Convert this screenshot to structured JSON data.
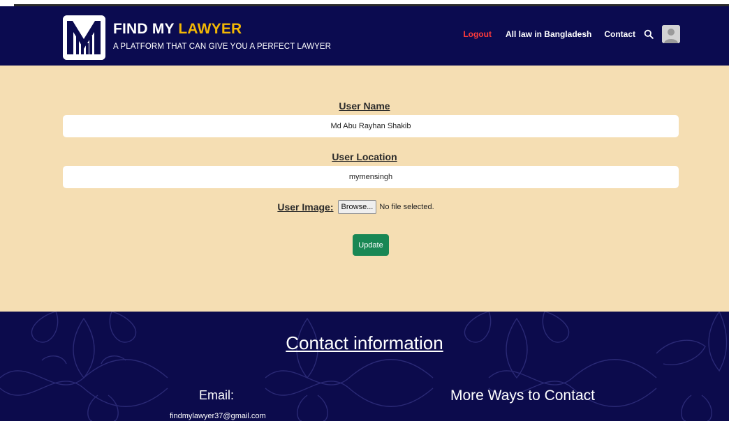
{
  "header": {
    "brand_title_part1": "FIND MY ",
    "brand_title_part2": "LAWYER",
    "brand_subtitle": "A PLATFORM THAT CAN GIVE YOU A PERFECT LAWYER",
    "nav": {
      "logout": "Logout",
      "all_law": "All law in Bangladesh",
      "contact": "Contact"
    },
    "icons": [
      "logo-m",
      "search-icon",
      "avatar-icon"
    ],
    "colors": {
      "navbar_bg": "#0b0b50",
      "accent": "#f2b705",
      "logout": "#ff3b3b"
    }
  },
  "form": {
    "user_name_label": "User Name",
    "user_name_value": "Md Abu Rayhan Shakib",
    "user_location_label": "User Location",
    "user_location_value": "mymensingh",
    "user_image_label": "User Image:",
    "browse_label": "Browse...",
    "file_status": "No file selected.",
    "update_label": "Update",
    "colors": {
      "background": "#f5deb3",
      "update_button": "#198754"
    }
  },
  "footer": {
    "title": "Contact information",
    "email_label": "Email:",
    "email_value": "findmylawyer37@gmail.com",
    "more_ways": "More Ways to Contact",
    "colors": {
      "background": "#0c0b4c"
    }
  }
}
